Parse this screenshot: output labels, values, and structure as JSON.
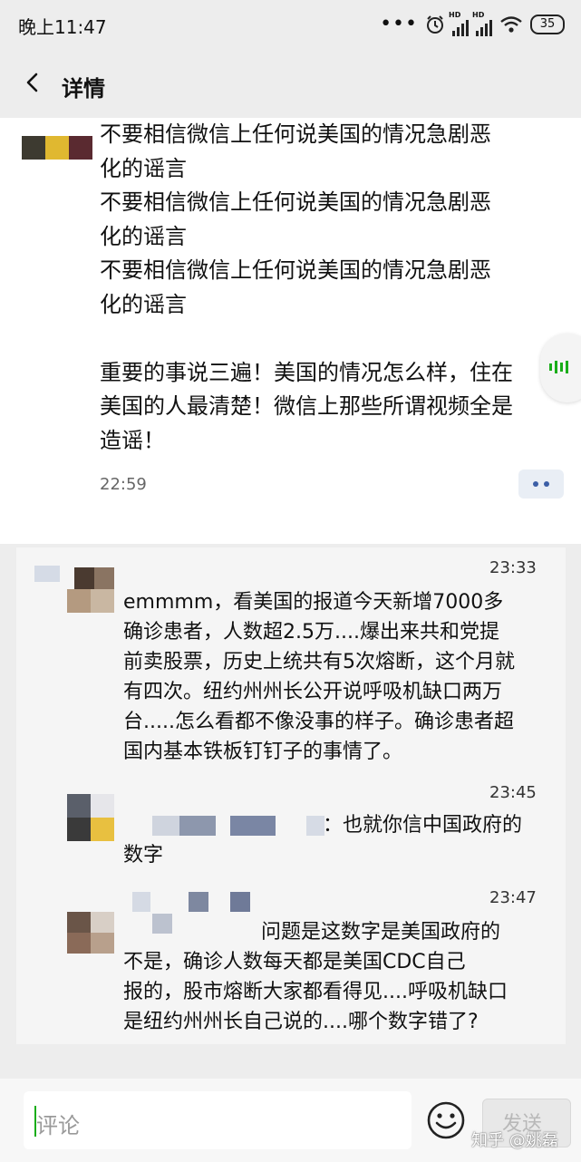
{
  "status_bar": {
    "time": "晚上11:47",
    "dots": "•••",
    "hd_label": "HD",
    "battery": "35"
  },
  "header": {
    "title": "详情"
  },
  "post": {
    "text": "不要相信微信上任何说美国的情况急剧恶\n化的谣言\n不要相信微信上任何说美国的情况急剧恶\n化的谣言\n不要相信微信上任何说美国的情况急剧恶\n化的谣言\n\n重要的事说三遍！美国的情况怎么样，住在\n美国的人最清楚！微信上那些所谓视频全是\n造谣！",
    "time": "22:59"
  },
  "comments": [
    {
      "time": "23:33",
      "text": "emmmm，看美国的报道今天新增7000多\n确诊患者，人数超2.5万....爆出来共和党提\n前卖股票，历史上统共有5次熔断，这个月就\n有四次。纽约州州长公开说呼吸机缺口两万\n台.....怎么看都不像没事的样子。确诊患者超\n国内基本铁板钉钉子的事情了。"
    },
    {
      "time": "23:45",
      "text": "：也就你信中国政府的\n数字"
    },
    {
      "time": "23:47",
      "text": "问题是这数字是美国政府的\n不是，确诊人数每天都是美国CDC自己\n报的，股市熔断大家都看得见....呼吸机缺口\n是纽约州州长自己说的....哪个数字错了?"
    }
  ],
  "bottom_bar": {
    "comment_placeholder": "评论",
    "send_label": "发送",
    "watermark": "知乎 @姚磊"
  },
  "colors": {
    "accent_green": "#1aad19",
    "link_blue": "#3b5ea6",
    "page_bg": "#ededed"
  },
  "icons": [
    "back-chevron-icon",
    "alarm-icon",
    "signal-icon",
    "wifi-icon",
    "battery-icon",
    "more-dots-icon",
    "voice-wave-icon",
    "emoji-icon"
  ]
}
